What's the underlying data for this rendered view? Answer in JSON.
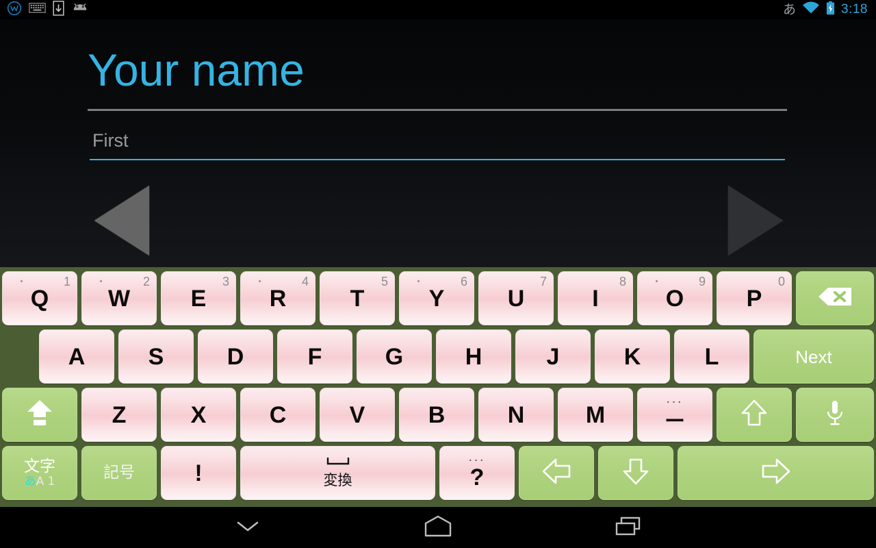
{
  "status_bar": {
    "left_icons": [
      "app-badge-icon",
      "keyboard-icon",
      "download-icon",
      "android-icon"
    ],
    "ime_indicator": "あ",
    "right_icons": [
      "wifi-icon",
      "battery-charging-icon"
    ],
    "clock": "3:18"
  },
  "content": {
    "title": "Your name",
    "input": {
      "value": "",
      "placeholder": "First"
    },
    "prev_button_label": "previous",
    "next_button_label": "next",
    "colors": {
      "accent": "#33b5e5",
      "title": "#34b4e4",
      "divider": "#7d7d7d"
    }
  },
  "keyboard": {
    "background_color": "#4b5e33",
    "key_pink": "#f6cdd2",
    "key_green": "#aed27e",
    "rows": [
      {
        "name": "row-1",
        "keys": [
          {
            "label": "Q",
            "hint": "1",
            "type": "pink",
            "dot": true
          },
          {
            "label": "W",
            "hint": "2",
            "type": "pink",
            "dot": true
          },
          {
            "label": "E",
            "hint": "3",
            "type": "pink",
            "dot": false
          },
          {
            "label": "R",
            "hint": "4",
            "type": "pink",
            "dot": true
          },
          {
            "label": "T",
            "hint": "5",
            "type": "pink",
            "dot": false
          },
          {
            "label": "Y",
            "hint": "6",
            "type": "pink",
            "dot": true
          },
          {
            "label": "U",
            "hint": "7",
            "type": "pink",
            "dot": false
          },
          {
            "label": "I",
            "hint": "8",
            "type": "pink",
            "dot": false
          },
          {
            "label": "O",
            "hint": "9",
            "type": "pink",
            "dot": true
          },
          {
            "label": "P",
            "hint": "0",
            "type": "pink",
            "dot": false
          },
          {
            "label": "",
            "icon": "backspace-icon",
            "type": "green"
          }
        ]
      },
      {
        "name": "row-2",
        "keys": [
          {
            "label": "A",
            "type": "pink"
          },
          {
            "label": "S",
            "type": "pink"
          },
          {
            "label": "D",
            "type": "pink"
          },
          {
            "label": "F",
            "type": "pink"
          },
          {
            "label": "G",
            "type": "pink"
          },
          {
            "label": "H",
            "type": "pink"
          },
          {
            "label": "J",
            "type": "pink"
          },
          {
            "label": "K",
            "type": "pink"
          },
          {
            "label": "L",
            "type": "pink"
          },
          {
            "label": "Next",
            "type": "green"
          }
        ]
      },
      {
        "name": "row-3",
        "keys": [
          {
            "label": "",
            "icon": "shift-icon",
            "type": "green"
          },
          {
            "label": "Z",
            "type": "pink"
          },
          {
            "label": "X",
            "type": "pink"
          },
          {
            "label": "C",
            "type": "pink"
          },
          {
            "label": "V",
            "type": "pink"
          },
          {
            "label": "B",
            "type": "pink"
          },
          {
            "label": "N",
            "type": "pink"
          },
          {
            "label": "M",
            "type": "pink"
          },
          {
            "label": "ー",
            "hint_dots": "...",
            "type": "pink"
          },
          {
            "label": "",
            "icon": "arrow-up-icon",
            "type": "green"
          },
          {
            "label": "",
            "icon": "microphone-icon",
            "type": "green"
          }
        ]
      },
      {
        "name": "row-4",
        "keys": [
          {
            "label": "文字",
            "sub_a": "あ",
            "sub_b": "A 1",
            "type": "green"
          },
          {
            "label": "記号",
            "type": "green"
          },
          {
            "label": "!",
            "type": "pink"
          },
          {
            "label": "変換",
            "icon": "space-bracket-icon",
            "type": "pink"
          },
          {
            "label": "?",
            "hint_dots": "...",
            "type": "pink"
          },
          {
            "label": "",
            "icon": "arrow-left-icon",
            "type": "green"
          },
          {
            "label": "",
            "icon": "arrow-down-icon",
            "type": "green"
          },
          {
            "label": "",
            "icon": "arrow-right-icon",
            "type": "green"
          }
        ]
      }
    ]
  },
  "nav_bar": {
    "buttons": [
      {
        "name": "hide-keyboard-button",
        "icon": "chevron-down-icon"
      },
      {
        "name": "home-button",
        "icon": "home-icon"
      },
      {
        "name": "recents-button",
        "icon": "recents-icon"
      }
    ]
  }
}
